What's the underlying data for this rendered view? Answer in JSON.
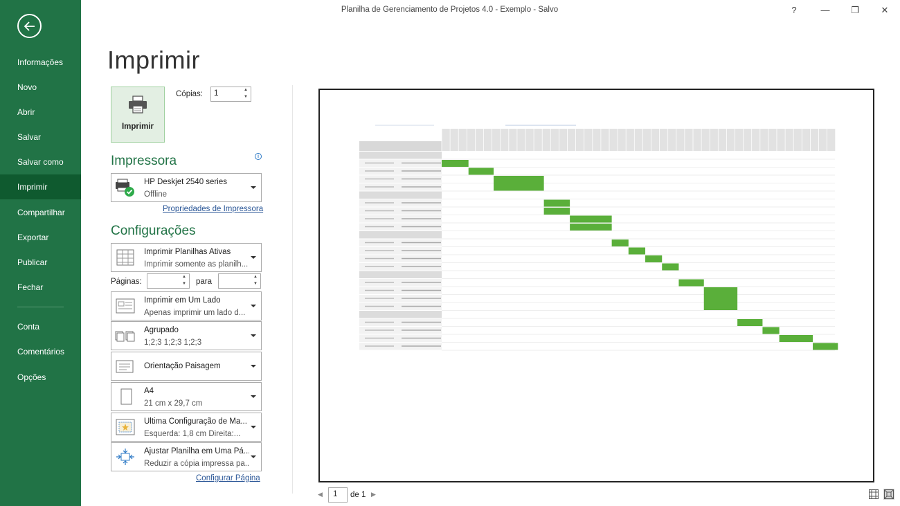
{
  "window": {
    "title": "Planilha de Gerenciamento de Projetos 4.0 - Exemplo  -  Salvo",
    "help": "?",
    "minimize": "—",
    "restore": "❐",
    "close": "✕"
  },
  "sidebar": {
    "items": [
      {
        "label": "Informações"
      },
      {
        "label": "Novo"
      },
      {
        "label": "Abrir"
      },
      {
        "label": "Salvar"
      },
      {
        "label": "Salvar como"
      },
      {
        "label": "Imprimir"
      },
      {
        "label": "Compartilhar"
      },
      {
        "label": "Exportar"
      },
      {
        "label": "Publicar"
      },
      {
        "label": "Fechar"
      },
      {
        "label": "Conta"
      },
      {
        "label": "Comentários"
      },
      {
        "label": "Opções"
      }
    ]
  },
  "print": {
    "title": "Imprimir",
    "button_label": "Imprimir",
    "copies_label": "Cópias:",
    "copies_value": "1"
  },
  "printer": {
    "section_title": "Impressora",
    "name": "HP Deskjet 2540 series",
    "status": "Offline",
    "properties_link": "Propriedades de Impressora"
  },
  "settings": {
    "section_title": "Configurações",
    "what": {
      "l1": "Imprimir Planilhas Ativas",
      "l2": "Imprimir somente as planilh..."
    },
    "pages_label": "Páginas:",
    "para_label": "para",
    "sides": {
      "l1": "Imprimir em Um Lado",
      "l2": "Apenas imprimir um lado d..."
    },
    "collate": {
      "l1": "Agrupado",
      "l2": "1;2;3    1;2;3    1;2;3"
    },
    "orientation": {
      "l1": "Orientação Paisagem"
    },
    "paper": {
      "l1": "A4",
      "l2": "21 cm x 29,7 cm"
    },
    "margins": {
      "l1": "Última Configuração de Ma...",
      "l2": "Esquerda:  1,8 cm    Direita:..."
    },
    "scaling": {
      "l1": "Ajustar Planilha em Uma Pá...",
      "l2": "Reduzir a cópia impressa pa..."
    },
    "page_setup_link": "Configurar Página"
  },
  "preview": {
    "page_number": "1",
    "page_of": "de 1",
    "bar_color": "#5aaf3a"
  }
}
